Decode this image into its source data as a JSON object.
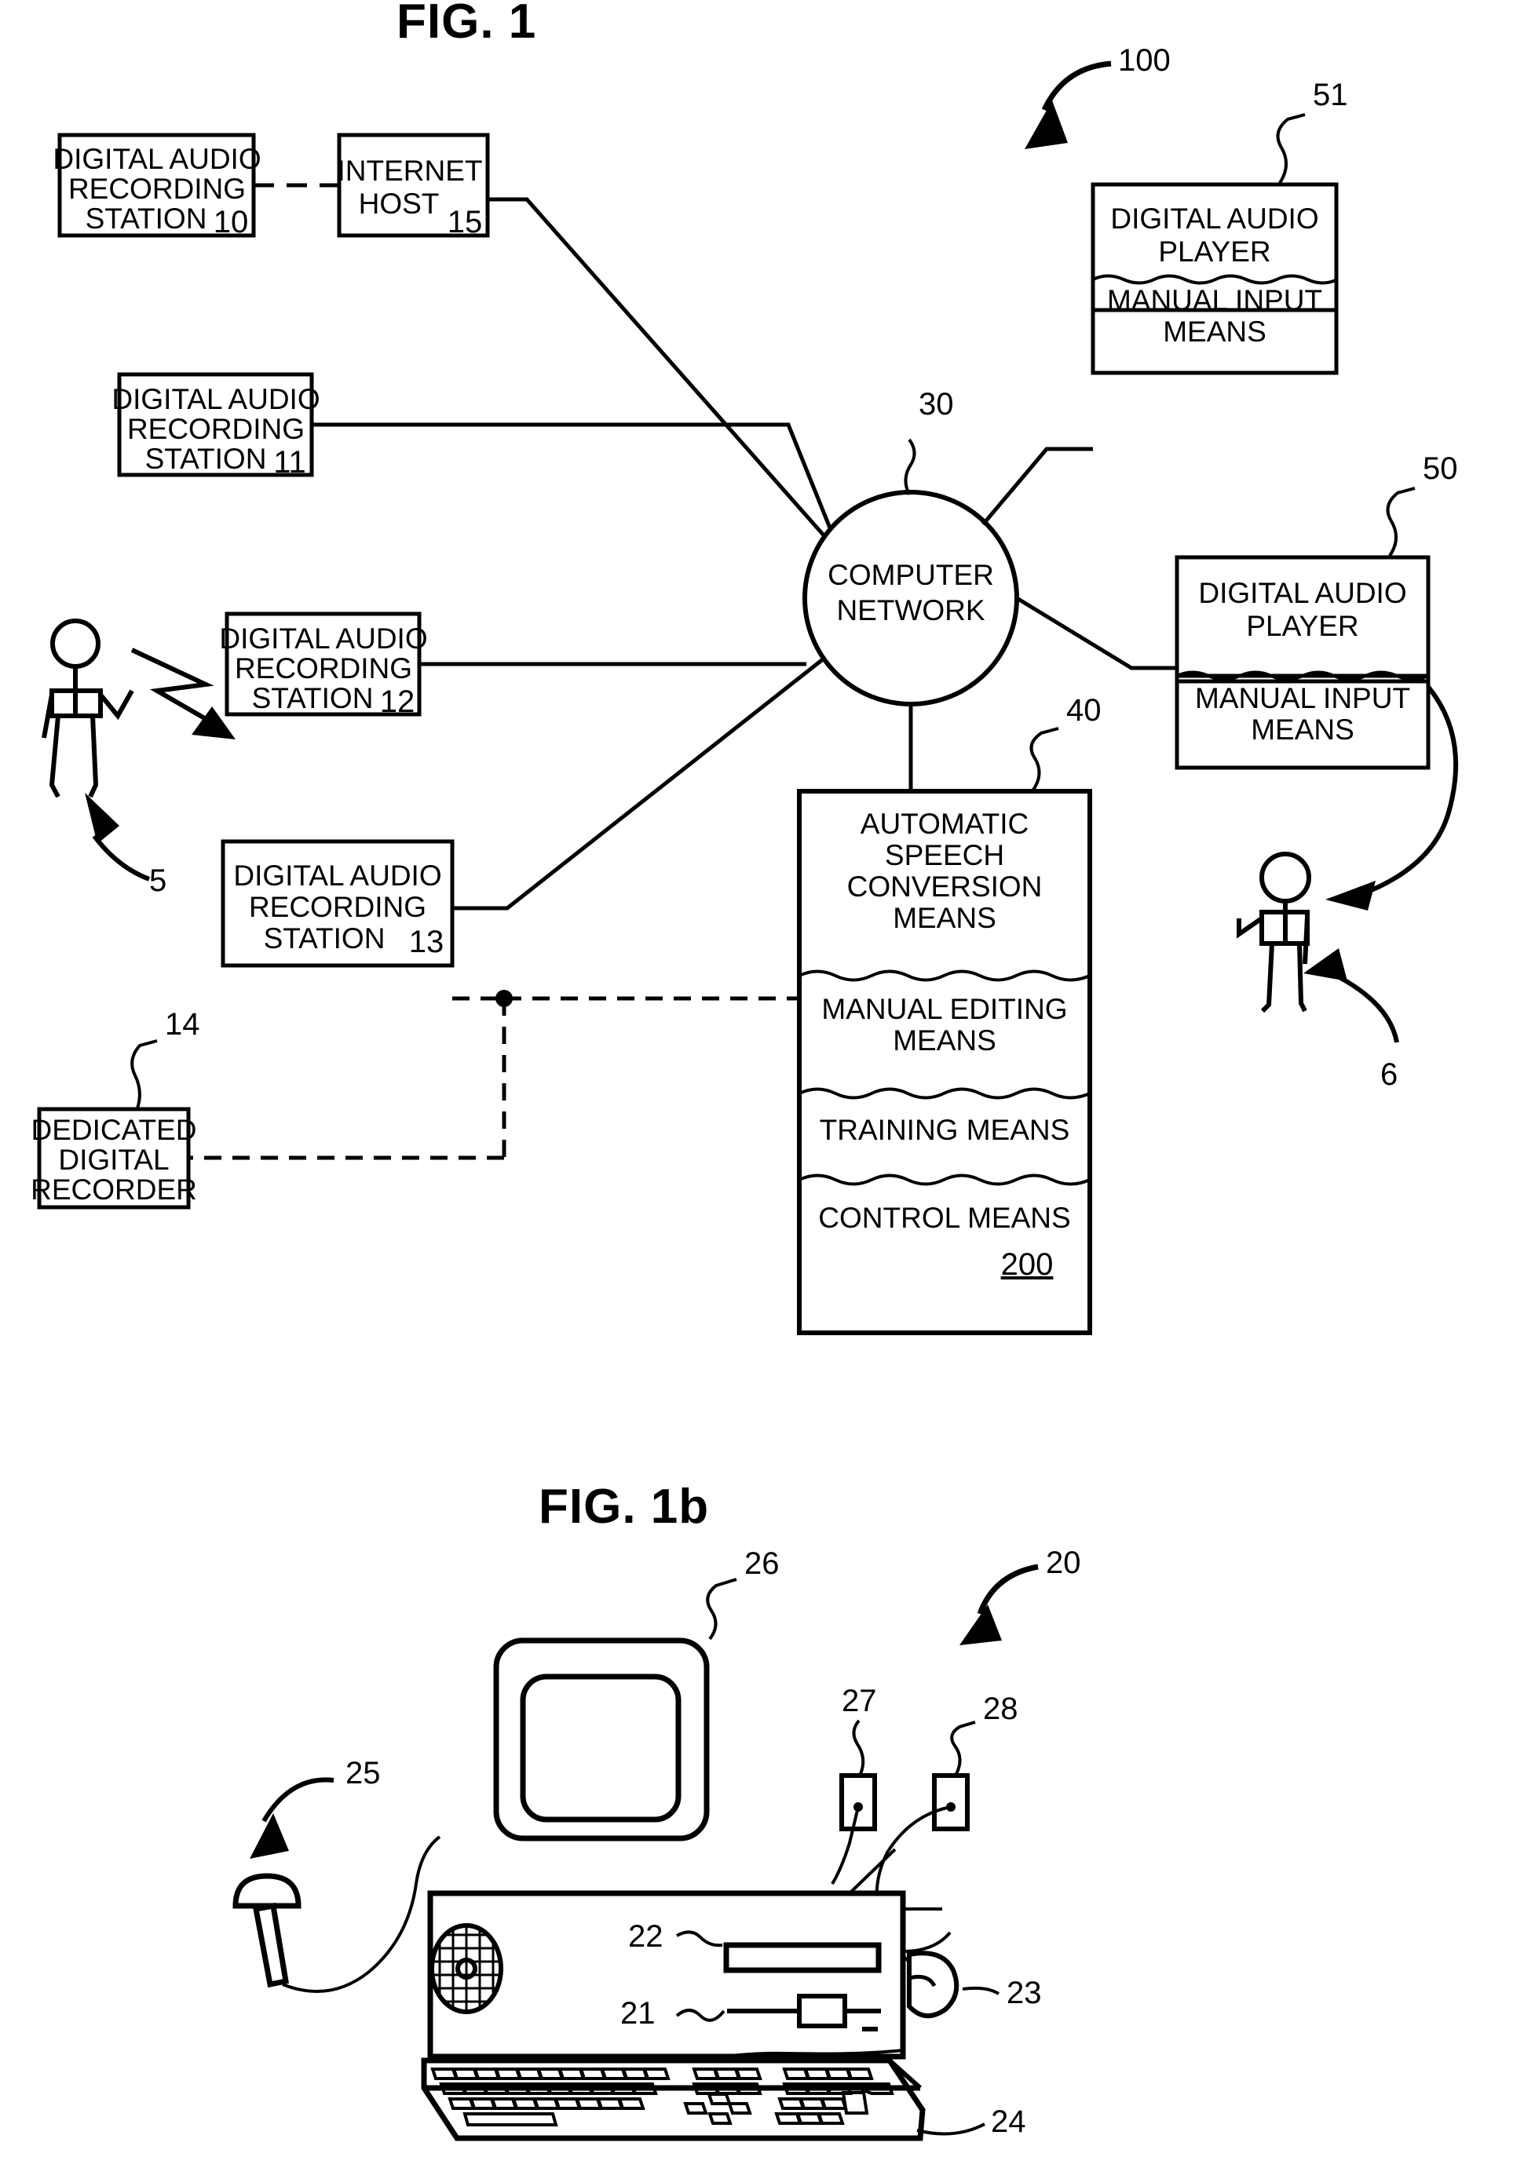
{
  "figures": [
    {
      "id": "fig1",
      "title": "FIG. 1"
    },
    {
      "id": "fig1b",
      "title": "FIG. 1b"
    }
  ],
  "fig1": {
    "title": "FIG. 1",
    "system_ref": "100",
    "nodes": {
      "das10": {
        "lines": [
          "DIGITAL AUDIO",
          "RECORDING",
          "STATION"
        ],
        "ref": "10"
      },
      "internet_host": {
        "lines": [
          "INTERNET",
          "HOST"
        ],
        "ref": "15"
      },
      "das11": {
        "lines": [
          "DIGITAL AUDIO",
          "RECORDING",
          "STATION"
        ],
        "ref": "11"
      },
      "das12": {
        "lines": [
          "DIGITAL AUDIO",
          "RECORDING",
          "STATION"
        ],
        "ref": "12"
      },
      "das13": {
        "lines": [
          "DIGITAL AUDIO",
          "RECORDING",
          "STATION"
        ],
        "ref": "13"
      },
      "dedicated_recorder": {
        "lines": [
          "DEDICATED",
          "DIGITAL",
          "RECORDER"
        ],
        "ref": "14"
      },
      "computer_network": {
        "lines": [
          "COMPUTER",
          "NETWORK"
        ],
        "ref": "30"
      },
      "player51": {
        "ref": "51",
        "sections": [
          {
            "lines": [
              "DIGITAL AUDIO",
              "PLAYER"
            ]
          },
          {
            "lines": [
              "MANUAL INPUT",
              "MEANS"
            ]
          }
        ]
      },
      "player50": {
        "ref": "50",
        "sections": [
          {
            "lines": [
              "DIGITAL AUDIO",
              "PLAYER"
            ]
          },
          {
            "lines": [
              "MANUAL INPUT",
              "MEANS"
            ]
          }
        ]
      },
      "asc40": {
        "ref": "40",
        "sections": [
          {
            "lines": [
              "AUTOMATIC",
              "SPEECH",
              "CONVERSION",
              "MEANS"
            ]
          },
          {
            "lines": [
              "MANUAL EDITING",
              "MEANS"
            ]
          },
          {
            "lines": [
              "TRAINING MEANS"
            ]
          },
          {
            "lines": [
              "CONTROL MEANS"
            ],
            "ref": "200",
            "ref_underlined": true
          }
        ]
      },
      "speaker_person": {
        "ref": "5"
      },
      "listener_person": {
        "ref": "6"
      }
    }
  },
  "fig1b": {
    "title": "FIG. 1b",
    "system_ref": "20",
    "parts": {
      "monitor": {
        "ref": "26"
      },
      "port27": {
        "ref": "27"
      },
      "port28": {
        "ref": "28"
      },
      "microphone": {
        "ref": "25"
      },
      "cdrom_slot": {
        "ref": "22"
      },
      "floppy_slot": {
        "ref": "21"
      },
      "mouse": {
        "ref": "23"
      },
      "keyboard": {
        "ref": "24"
      }
    }
  },
  "style": {
    "ink": "#000000",
    "paper": "#ffffff"
  }
}
